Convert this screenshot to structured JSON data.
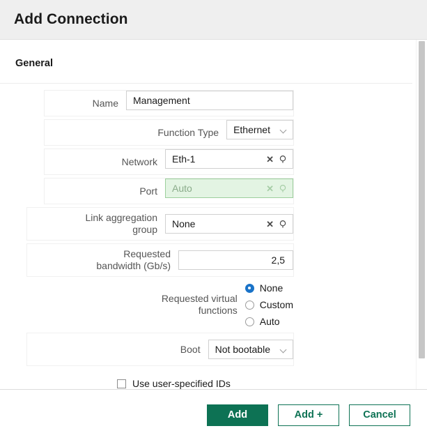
{
  "dialog": {
    "title": "Add Connection",
    "section_heading": "General"
  },
  "form": {
    "name": {
      "label": "Name",
      "value": "Management"
    },
    "function_type": {
      "label": "Function Type",
      "value": "Ethernet",
      "chevron_icon": "chevron-down-icon"
    },
    "network": {
      "label": "Network",
      "value": "Eth-1",
      "clear_icon": "clear-icon",
      "search_icon": "search-icon"
    },
    "port": {
      "label": "Port",
      "value": "Auto",
      "clear_icon": "clear-icon",
      "search_icon": "search-icon",
      "highlight_fill": "#e3f4e3",
      "highlight_border": "#9ccf9c"
    },
    "link_aggregation_group": {
      "label": "Link aggregation\ngroup",
      "value": "None",
      "clear_icon": "clear-icon",
      "search_icon": "search-icon"
    },
    "requested_bandwidth": {
      "label": "Requested\nbandwidth (Gb/s)",
      "value": "2,5"
    },
    "requested_virtual_functions": {
      "label": "Requested virtual\nfunctions",
      "options": [
        {
          "label": "None",
          "selected": true
        },
        {
          "label": "Custom",
          "selected": false
        },
        {
          "label": "Auto",
          "selected": false
        }
      ],
      "selected_color": "#1a73c8"
    },
    "boot": {
      "label": "Boot",
      "value": "Not bootable",
      "chevron_icon": "chevron-down-icon"
    },
    "use_user_specified_ids": {
      "label": "Use user-specified IDs",
      "checked": false
    }
  },
  "footer": {
    "add_label": "Add",
    "add_plus_label": "Add +",
    "cancel_label": "Cancel",
    "accent_color": "#0d7254"
  }
}
